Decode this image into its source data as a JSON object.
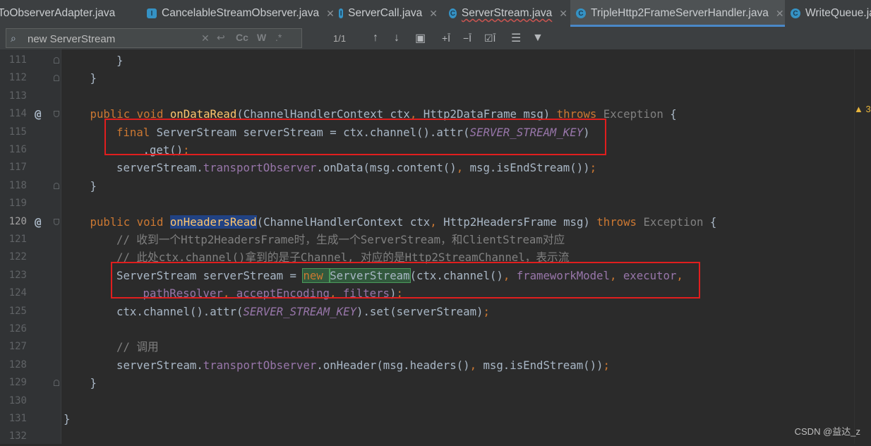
{
  "tabs": [
    {
      "label": "ToObserverAdapter.java",
      "icon": "class-icon"
    },
    {
      "label": "CancelableStreamObserver.java",
      "icon": "interface-icon"
    },
    {
      "label": "ServerCall.java",
      "icon": "interface-icon"
    },
    {
      "label": "ServerStream.java",
      "icon": "class-icon"
    },
    {
      "label": "TripleHttp2FrameServerHandler.java",
      "icon": "class-icon",
      "active": true
    },
    {
      "label": "WriteQueue.ja",
      "icon": "class-icon"
    }
  ],
  "search": {
    "value": "new ServerStream",
    "match_count": "1/1",
    "match_case": "Cc",
    "words": "W",
    "regex": ".*"
  },
  "editor": {
    "lines": [
      {
        "n": "111",
        "indent": 2,
        "tokens": [
          {
            "t": "}"
          }
        ]
      },
      {
        "n": "112",
        "indent": 1,
        "tokens": [
          {
            "t": "}"
          }
        ]
      },
      {
        "n": "113",
        "indent": 0,
        "tokens": []
      },
      {
        "n": "114",
        "indent": 1,
        "tokens": [
          {
            "t": "public ",
            "c": "kw"
          },
          {
            "t": "void ",
            "c": "kw"
          },
          {
            "t": "onDataRead",
            "c": "fn"
          },
          {
            "t": "(ChannelHandlerContext ctx"
          },
          {
            "t": ", ",
            "c": "kw"
          },
          {
            "t": "Http2DataFrame msg) "
          },
          {
            "t": "throws ",
            "c": "kw"
          },
          {
            "t": "Exception ",
            "c": "ex"
          },
          {
            "t": "{"
          }
        ]
      },
      {
        "n": "115",
        "indent": 2,
        "tokens": [
          {
            "t": "final ",
            "c": "kw"
          },
          {
            "t": "ServerStream serverStream = ctx.channel().attr("
          },
          {
            "t": "SERVER_STREAM_KEY",
            "c": "sfld"
          },
          {
            "t": ")"
          }
        ]
      },
      {
        "n": "116",
        "indent": 3,
        "tokens": [
          {
            "t": ".get()"
          },
          {
            "t": ";",
            "c": "kw"
          }
        ]
      },
      {
        "n": "117",
        "indent": 2,
        "tokens": [
          {
            "t": "serverStream."
          },
          {
            "t": "transportObserver",
            "c": "fld"
          },
          {
            "t": ".onData(msg.content()"
          },
          {
            "t": ", ",
            "c": "kw"
          },
          {
            "t": "msg.isEndStream())"
          },
          {
            "t": ";",
            "c": "kw"
          }
        ]
      },
      {
        "n": "118",
        "indent": 1,
        "tokens": [
          {
            "t": "}"
          }
        ]
      },
      {
        "n": "119",
        "indent": 0,
        "tokens": []
      },
      {
        "n": "120",
        "indent": 1,
        "tokens": [
          {
            "t": "public ",
            "c": "kw"
          },
          {
            "t": "void ",
            "c": "kw"
          },
          {
            "t": "onHeadersRead",
            "c": "hlsel"
          },
          {
            "t": "(ChannelHandlerContext ctx"
          },
          {
            "t": ", ",
            "c": "kw"
          },
          {
            "t": "Http2HeadersFrame msg) "
          },
          {
            "t": "throws ",
            "c": "kw"
          },
          {
            "t": "Exception ",
            "c": "ex"
          },
          {
            "t": "{"
          }
        ]
      },
      {
        "n": "121",
        "indent": 2,
        "tokens": [
          {
            "t": "// 收到一个Http2HeadersFrame时，生成一个ServerStream，和ClientStream对应",
            "c": "cm"
          }
        ]
      },
      {
        "n": "122",
        "indent": 2,
        "tokens": [
          {
            "t": "// 此处ctx.channel()拿到的是子Channel, 对应的是Http2StreamChannel，表示流",
            "c": "cm"
          }
        ]
      },
      {
        "n": "123",
        "indent": 2,
        "tokens": [
          {
            "t": "ServerStream serverStream = "
          },
          {
            "t": "new ",
            "c": "kw hlmatch"
          },
          {
            "t": "ServerStream",
            "c": "hlmatch"
          },
          {
            "t": "(ctx.channel()"
          },
          {
            "t": ", ",
            "c": "kw"
          },
          {
            "t": "frameworkModel",
            "c": "fld"
          },
          {
            "t": ", ",
            "c": "kw"
          },
          {
            "t": "executor",
            "c": "fld"
          },
          {
            "t": ",",
            "c": "kw"
          }
        ]
      },
      {
        "n": "124",
        "indent": 3,
        "tokens": [
          {
            "t": "pathResolver",
            "c": "fld"
          },
          {
            "t": ", ",
            "c": "kw"
          },
          {
            "t": "acceptEncoding",
            "c": "fld"
          },
          {
            "t": ", ",
            "c": "kw"
          },
          {
            "t": "filters",
            "c": "fld"
          },
          {
            "t": ")"
          },
          {
            "t": ";",
            "c": "kw"
          }
        ]
      },
      {
        "n": "125",
        "indent": 2,
        "tokens": [
          {
            "t": "ctx.channel().attr("
          },
          {
            "t": "SERVER_STREAM_KEY",
            "c": "sfld"
          },
          {
            "t": ").set(serverStream)"
          },
          {
            "t": ";",
            "c": "kw"
          }
        ]
      },
      {
        "n": "126",
        "indent": 0,
        "tokens": []
      },
      {
        "n": "127",
        "indent": 2,
        "tokens": [
          {
            "t": "// 调用",
            "c": "cm"
          }
        ]
      },
      {
        "n": "128",
        "indent": 2,
        "tokens": [
          {
            "t": "serverStream."
          },
          {
            "t": "transportObserver",
            "c": "fld"
          },
          {
            "t": ".onHeader(msg.headers()"
          },
          {
            "t": ", ",
            "c": "kw"
          },
          {
            "t": "msg.isEndStream())"
          },
          {
            "t": ";",
            "c": "kw"
          }
        ]
      },
      {
        "n": "129",
        "indent": 1,
        "tokens": [
          {
            "t": "}"
          }
        ]
      },
      {
        "n": "130",
        "indent": 0,
        "tokens": []
      },
      {
        "n": "131",
        "indent": 0,
        "tokens": [
          {
            "t": "}"
          }
        ]
      },
      {
        "n": "132",
        "indent": 0,
        "tokens": []
      }
    ]
  },
  "warning_count": "3",
  "watermark": "CSDN @益达_z"
}
